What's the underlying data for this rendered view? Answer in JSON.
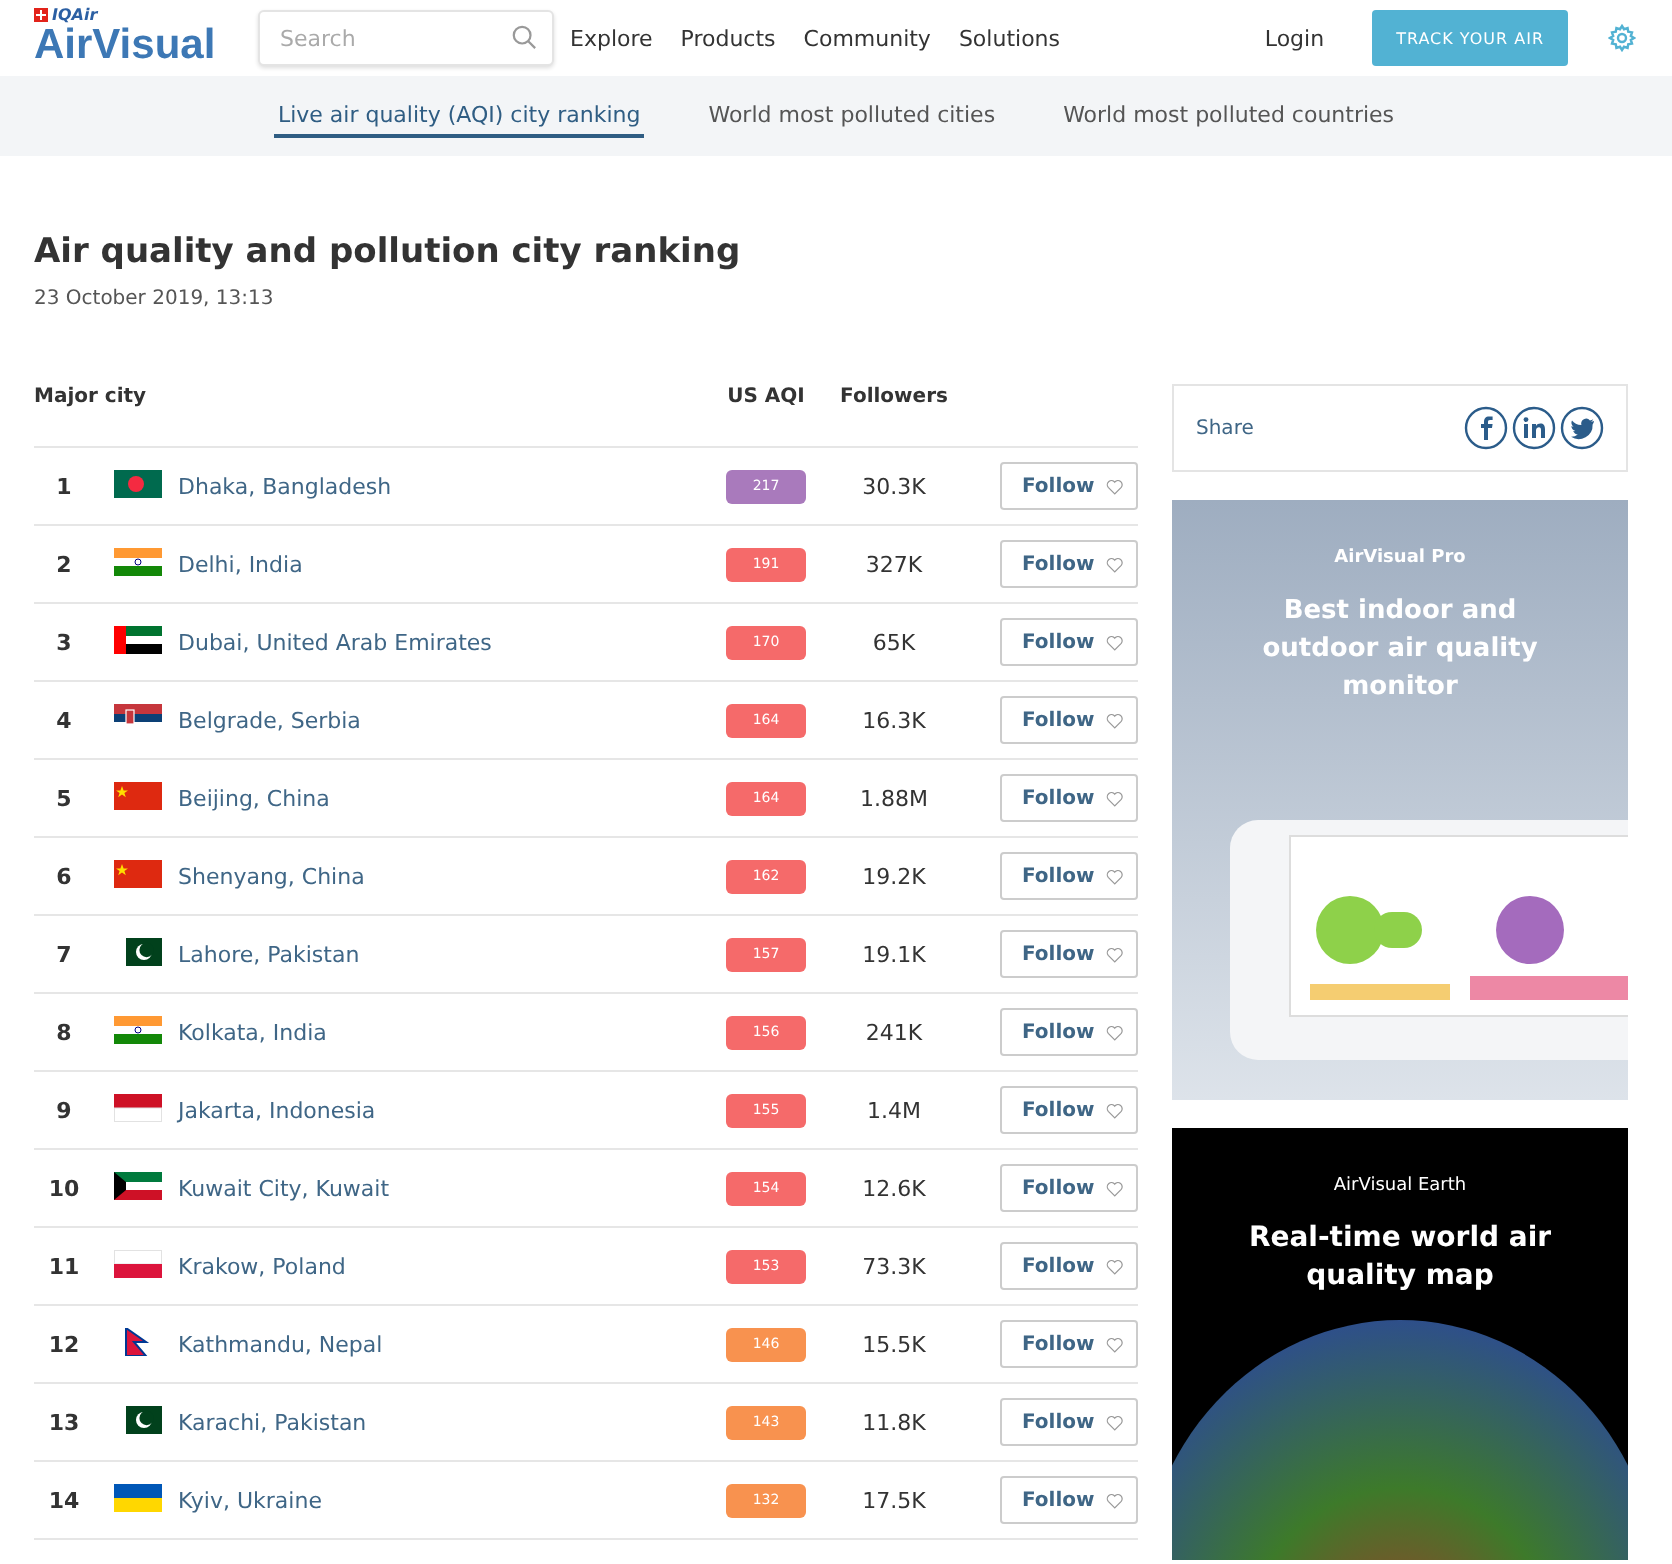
{
  "header": {
    "logo_brand": "IQAir",
    "logo": "AirVisual",
    "search": {
      "placeholder": "Search"
    },
    "nav": [
      "Explore",
      "Products",
      "Community",
      "Solutions"
    ],
    "login": "Login",
    "cta": "TRACK YOUR AIR"
  },
  "subnav": [
    {
      "label": "Live air quality (AQI) city ranking",
      "selected": true
    },
    {
      "label": "World most polluted cities",
      "selected": false
    },
    {
      "label": "World most polluted countries",
      "selected": false
    }
  ],
  "title": "Air quality and pollution city ranking",
  "date": "23 October 2019, 13:13",
  "table": {
    "columns": [
      "Major city",
      "US AQI",
      "Followers"
    ],
    "rows": [
      {
        "rank": "1",
        "kind": "bd",
        "city": "Dhaka, Bangladesh",
        "aqi": "217",
        "color": "#a97abc",
        "followers": "30.3K",
        "button": "Follow"
      },
      {
        "rank": "2",
        "kind": "in",
        "city": "Delhi, India",
        "aqi": "191",
        "color": "#f56a6a",
        "followers": "327K",
        "button": "Follow"
      },
      {
        "rank": "3",
        "kind": "ae",
        "city": "Dubai, United Arab Emirates",
        "aqi": "170",
        "color": "#f56a6a",
        "followers": "65K",
        "button": "Follow"
      },
      {
        "rank": "4",
        "kind": "rs",
        "city": "Belgrade, Serbia",
        "aqi": "164",
        "color": "#f56a6a",
        "followers": "16.3K",
        "button": "Follow"
      },
      {
        "rank": "5",
        "kind": "cn",
        "city": "Beijing, China",
        "aqi": "164",
        "color": "#f56a6a",
        "followers": "1.88M",
        "button": "Follow"
      },
      {
        "rank": "6",
        "kind": "cn",
        "city": "Shenyang, China",
        "aqi": "162",
        "color": "#f56a6a",
        "followers": "19.2K",
        "button": "Follow"
      },
      {
        "rank": "7",
        "kind": "pk",
        "city": "Lahore, Pakistan",
        "aqi": "157",
        "color": "#f56a6a",
        "followers": "19.1K",
        "button": "Follow"
      },
      {
        "rank": "8",
        "kind": "in",
        "city": "Kolkata, India",
        "aqi": "156",
        "color": "#f56a6a",
        "followers": "241K",
        "button": "Follow"
      },
      {
        "rank": "9",
        "kind": "id",
        "city": "Jakarta, Indonesia",
        "aqi": "155",
        "color": "#f56a6a",
        "followers": "1.4M",
        "button": "Follow"
      },
      {
        "rank": "10",
        "kind": "kw",
        "city": "Kuwait City, Kuwait",
        "aqi": "154",
        "color": "#f56a6a",
        "followers": "12.6K",
        "button": "Follow"
      },
      {
        "rank": "11",
        "kind": "pl",
        "city": "Krakow, Poland",
        "aqi": "153",
        "color": "#f56a6a",
        "followers": "73.3K",
        "button": "Follow"
      },
      {
        "rank": "12",
        "kind": "np",
        "city": "Kathmandu, Nepal",
        "aqi": "146",
        "color": "#f8924f",
        "followers": "15.5K",
        "button": "Follow"
      },
      {
        "rank": "13",
        "kind": "pk",
        "city": "Karachi, Pakistan",
        "aqi": "143",
        "color": "#f8924f",
        "followers": "11.8K",
        "button": "Follow"
      },
      {
        "rank": "14",
        "kind": "ua",
        "city": "Kyiv, Ukraine",
        "aqi": "132",
        "color": "#f8924f",
        "followers": "17.5K",
        "button": "Follow"
      }
    ]
  },
  "share": {
    "label": "Share"
  },
  "promos": [
    {
      "kind": "pro",
      "eyebrow": "AirVisual Pro",
      "headline": "Best indoor and outdoor air quality monitor"
    },
    {
      "kind": "earth",
      "eyebrow": "AirVisual Earth",
      "headline": "Real-time world air quality map"
    }
  ]
}
